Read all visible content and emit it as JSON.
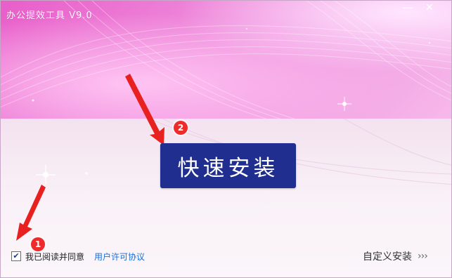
{
  "window": {
    "title": "办公提效工具 V9.0",
    "minimize_glyph": "—",
    "close_glyph": "✕"
  },
  "main": {
    "install_button_label": "快速安装",
    "badge_1": "1",
    "badge_2": "2"
  },
  "footer": {
    "agree_checked": true,
    "check_glyph": "✔",
    "agree_text": "我已阅读并同意",
    "license_link": "用户许可协议",
    "custom_install_label": "自定义安装",
    "custom_install_chevrons": "›››"
  },
  "colors": {
    "accent_button": "#1f2e8f",
    "badge_red": "#ee2a2a",
    "link_blue": "#1a6fd6",
    "hero_pink": "#e85ec9"
  },
  "icons": [
    "minimize-icon",
    "close-icon",
    "checkmark-icon",
    "chevron-right-icon",
    "arrow-icon"
  ]
}
